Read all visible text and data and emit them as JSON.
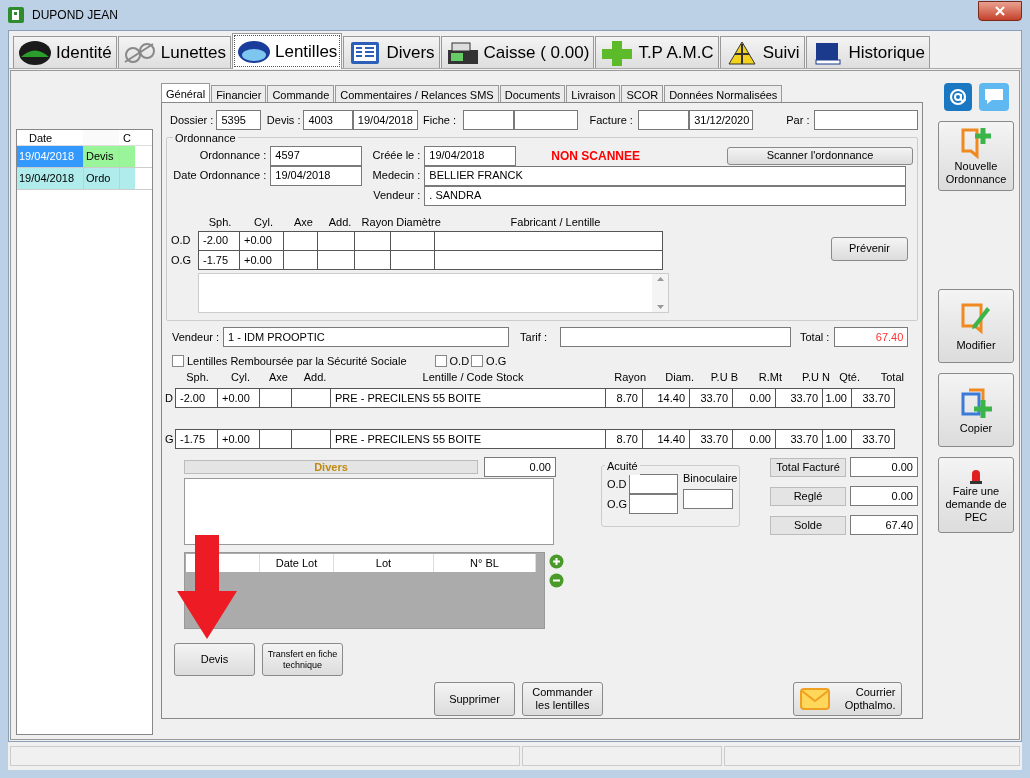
{
  "window": {
    "title": "DUPOND JEAN"
  },
  "main_tabs": [
    {
      "label": "Identité",
      "selected": false
    },
    {
      "label": "Lunettes",
      "selected": false
    },
    {
      "label": "Lentilles",
      "selected": true
    },
    {
      "label": "Divers",
      "selected": false
    },
    {
      "label": "Caisse ( 0.00)",
      "selected": false
    },
    {
      "label": "T.P A.M.C",
      "selected": false
    },
    {
      "label": "Suivi",
      "selected": false
    },
    {
      "label": "Historique",
      "selected": false
    }
  ],
  "history": {
    "columns": [
      "Date",
      "C"
    ],
    "rows": [
      {
        "date": "19/04/2018",
        "type": "Devis",
        "selected": true
      },
      {
        "date": "19/04/2018",
        "type": "Ordo",
        "selected": false
      }
    ]
  },
  "sub_tabs": [
    {
      "label": "Général",
      "selected": true
    },
    {
      "label": "Financier",
      "selected": false
    },
    {
      "label": "Commande",
      "selected": false
    },
    {
      "label": "Commentaires / Relances SMS",
      "selected": false
    },
    {
      "label": "Documents",
      "selected": false
    },
    {
      "label": "Livraison",
      "selected": false
    },
    {
      "label": "SCOR",
      "selected": false
    },
    {
      "label": "Données Normalisées",
      "selected": false
    }
  ],
  "header": {
    "dossier_label": "Dossier :",
    "dossier": "5395",
    "devis_label": "Devis :",
    "devis": "4003",
    "devis_date": "19/04/2018",
    "fiche_label": "Fiche :",
    "facture_label": "Facture :",
    "facture_date": "31/12/2020",
    "par_label": "Par :"
  },
  "ordonnance": {
    "title": "Ordonnance",
    "number_label": "Ordonnance :",
    "number": "4597",
    "date_label": "Date Ordonnance :",
    "date": "19/04/2018",
    "created_label": "Créée le :",
    "created": "19/04/2018",
    "status": "NON SCANNEE",
    "scan_button": "Scanner l'ordonnance",
    "medecin_label": "Medecin :",
    "medecin": "BELLIER FRANCK",
    "vendeur_label": "Vendeur :",
    "vendeur": ". SANDRA",
    "columns": [
      "Sph.",
      "Cyl.",
      "Axe",
      "Add.",
      "Rayon",
      "Diamètre",
      "Fabricant / Lentille"
    ],
    "rows": [
      {
        "eye": "O.D",
        "cells": [
          "-2.00",
          "+0.00",
          "",
          "",
          "",
          "",
          ""
        ]
      },
      {
        "eye": "O.G",
        "cells": [
          "-1.75",
          "+0.00",
          "",
          "",
          "",
          "",
          ""
        ]
      }
    ],
    "prevenir_button": "Prévenir"
  },
  "sale": {
    "vendeur_label": "Vendeur :",
    "vendeur": "1 - IDM PROOPTIC",
    "tarif_label": "Tarif :",
    "total_label": "Total :",
    "total": "67.40"
  },
  "checks": [
    {
      "label": "Lentilles Remboursée par la Sécurité Sociale",
      "checked": false
    },
    {
      "label": "O.D",
      "checked": false
    },
    {
      "label": "O.G",
      "checked": false
    }
  ],
  "lenses": {
    "columns": [
      "Sph.",
      "Cyl.",
      "Axe",
      "Add.",
      "Lentille / Code Stock",
      "Rayon",
      "Diam.",
      "P.U B",
      "R.Mt",
      "P.U N",
      "Qté.",
      "Total"
    ],
    "rows": [
      {
        "eye": "D",
        "cells": [
          "-2.00",
          "+0.00",
          "",
          "",
          "PRE - PRECILENS 55  BOITE",
          "8.70",
          "14.40",
          "33.70",
          "0.00",
          "33.70",
          "1.00",
          "33.70"
        ]
      },
      {
        "eye": "G",
        "cells": [
          "-1.75",
          "+0.00",
          "",
          "",
          "PRE - PRECILENS 55  BOITE",
          "8.70",
          "14.40",
          "33.70",
          "0.00",
          "33.70",
          "1.00",
          "33.70"
        ]
      }
    ]
  },
  "divers": {
    "title": "Divers",
    "amount": "0.00"
  },
  "lots": {
    "columns": [
      "Date Lot",
      "Lot",
      "N° BL"
    ]
  },
  "acuite": {
    "title": "Acuité",
    "od_label": "O.D",
    "og_label": "O.G",
    "bino_label": "Binoculaire"
  },
  "totals": [
    {
      "label": "Total Facturé",
      "value": "0.00"
    },
    {
      "label": "Reglé",
      "value": "0.00"
    },
    {
      "label": "Solde",
      "value": "67.40"
    }
  ],
  "buttons": {
    "devis": "Devis",
    "transfert": "Transfert en fiche technique",
    "supprimer": "Supprimer",
    "commander": "Commander les lentilles",
    "courrier": "Courrier Opthalmo."
  },
  "side_buttons": [
    {
      "label": "Nouvelle Ordonnance",
      "kind": "new"
    },
    {
      "label": "Modifier",
      "kind": "edit"
    },
    {
      "label": "Copier",
      "kind": "copy"
    },
    {
      "label": "Faire une demande de PEC",
      "kind": "alarm"
    }
  ]
}
